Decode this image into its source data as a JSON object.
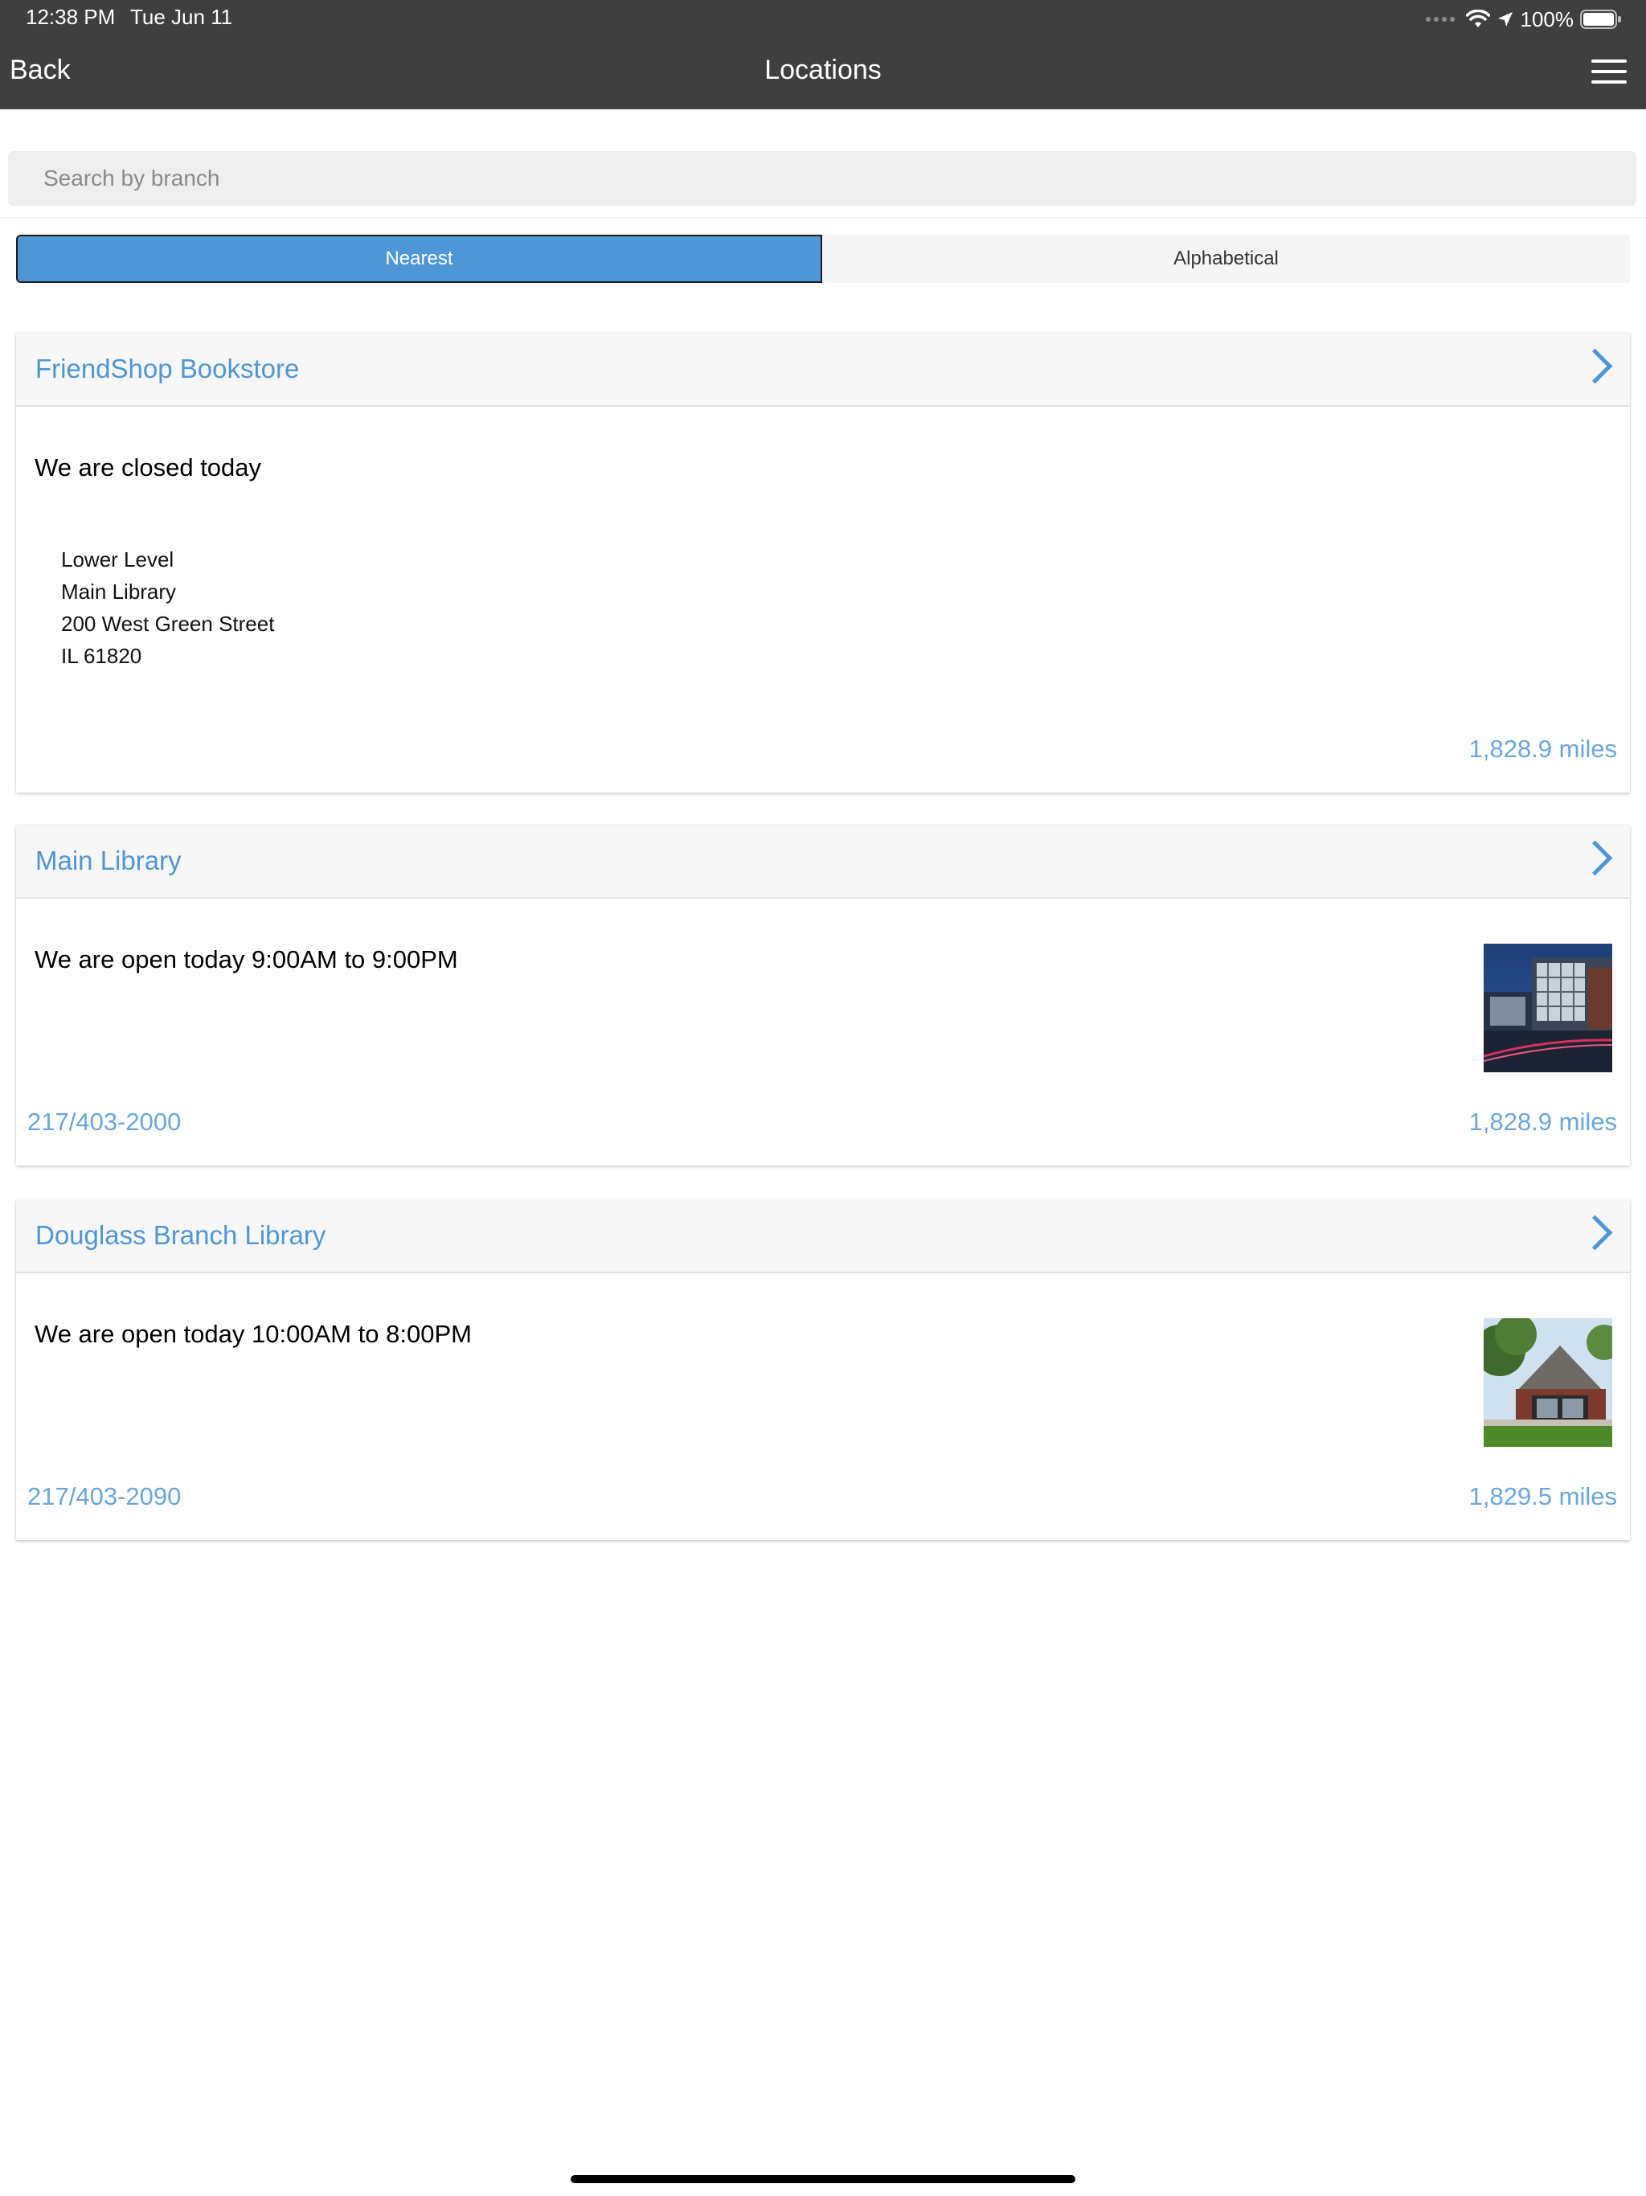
{
  "status_bar": {
    "time": "12:38 PM",
    "date": "Tue Jun 11",
    "battery": "100%"
  },
  "nav": {
    "back_label": "Back",
    "title": "Locations",
    "menu_icon": "hamburger-menu-icon"
  },
  "search": {
    "placeholder": "Search by branch",
    "value": ""
  },
  "sort": {
    "options": [
      "Nearest",
      "Alphabetical"
    ],
    "selected": "Nearest"
  },
  "colors": {
    "nav_bg": "#3f3f40",
    "accent": "#4f96d5",
    "link": "#6aa6db"
  },
  "locations": [
    {
      "name": "FriendShop Bookstore",
      "hours": "We are closed today",
      "address": [
        "Lower Level",
        "Main Library",
        "200 West Green Street",
        "IL 61820"
      ],
      "phone": "",
      "distance": "1,828.9 miles"
    },
    {
      "name": "Main Library",
      "hours": "We are open today 9:00AM to 9:00PM",
      "phone": "217/403-2000",
      "distance": "1,828.9 miles",
      "image": "main-library-building-photo"
    },
    {
      "name": "Douglass Branch Library",
      "hours": "We are open today 10:00AM to 8:00PM",
      "phone": "217/403-2090",
      "distance": "1,829.5 miles",
      "image": "douglass-branch-building-photo"
    }
  ]
}
